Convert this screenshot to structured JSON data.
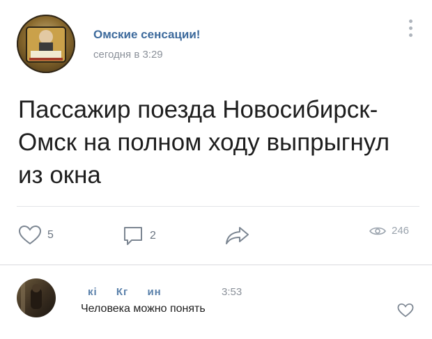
{
  "post": {
    "author": "Омские сенсации!",
    "time": "сегодня в 3:29",
    "text": "Пассажир поезда Новосибирск-Омск на полном ходу выпрыгнул из окна",
    "likes": "5",
    "comments": "2",
    "views": "246"
  },
  "comment": {
    "author_parts": [
      "кі",
      "Кг",
      "ин"
    ],
    "time": "3:53",
    "text": "Человека можно понять"
  },
  "colors": {
    "link": "#3d6a9c",
    "muted": "#8a9099",
    "text": "#1e1e1e"
  },
  "icons": [
    "heart-icon",
    "comment-icon",
    "share-icon",
    "eye-icon",
    "more-vertical-icon"
  ]
}
